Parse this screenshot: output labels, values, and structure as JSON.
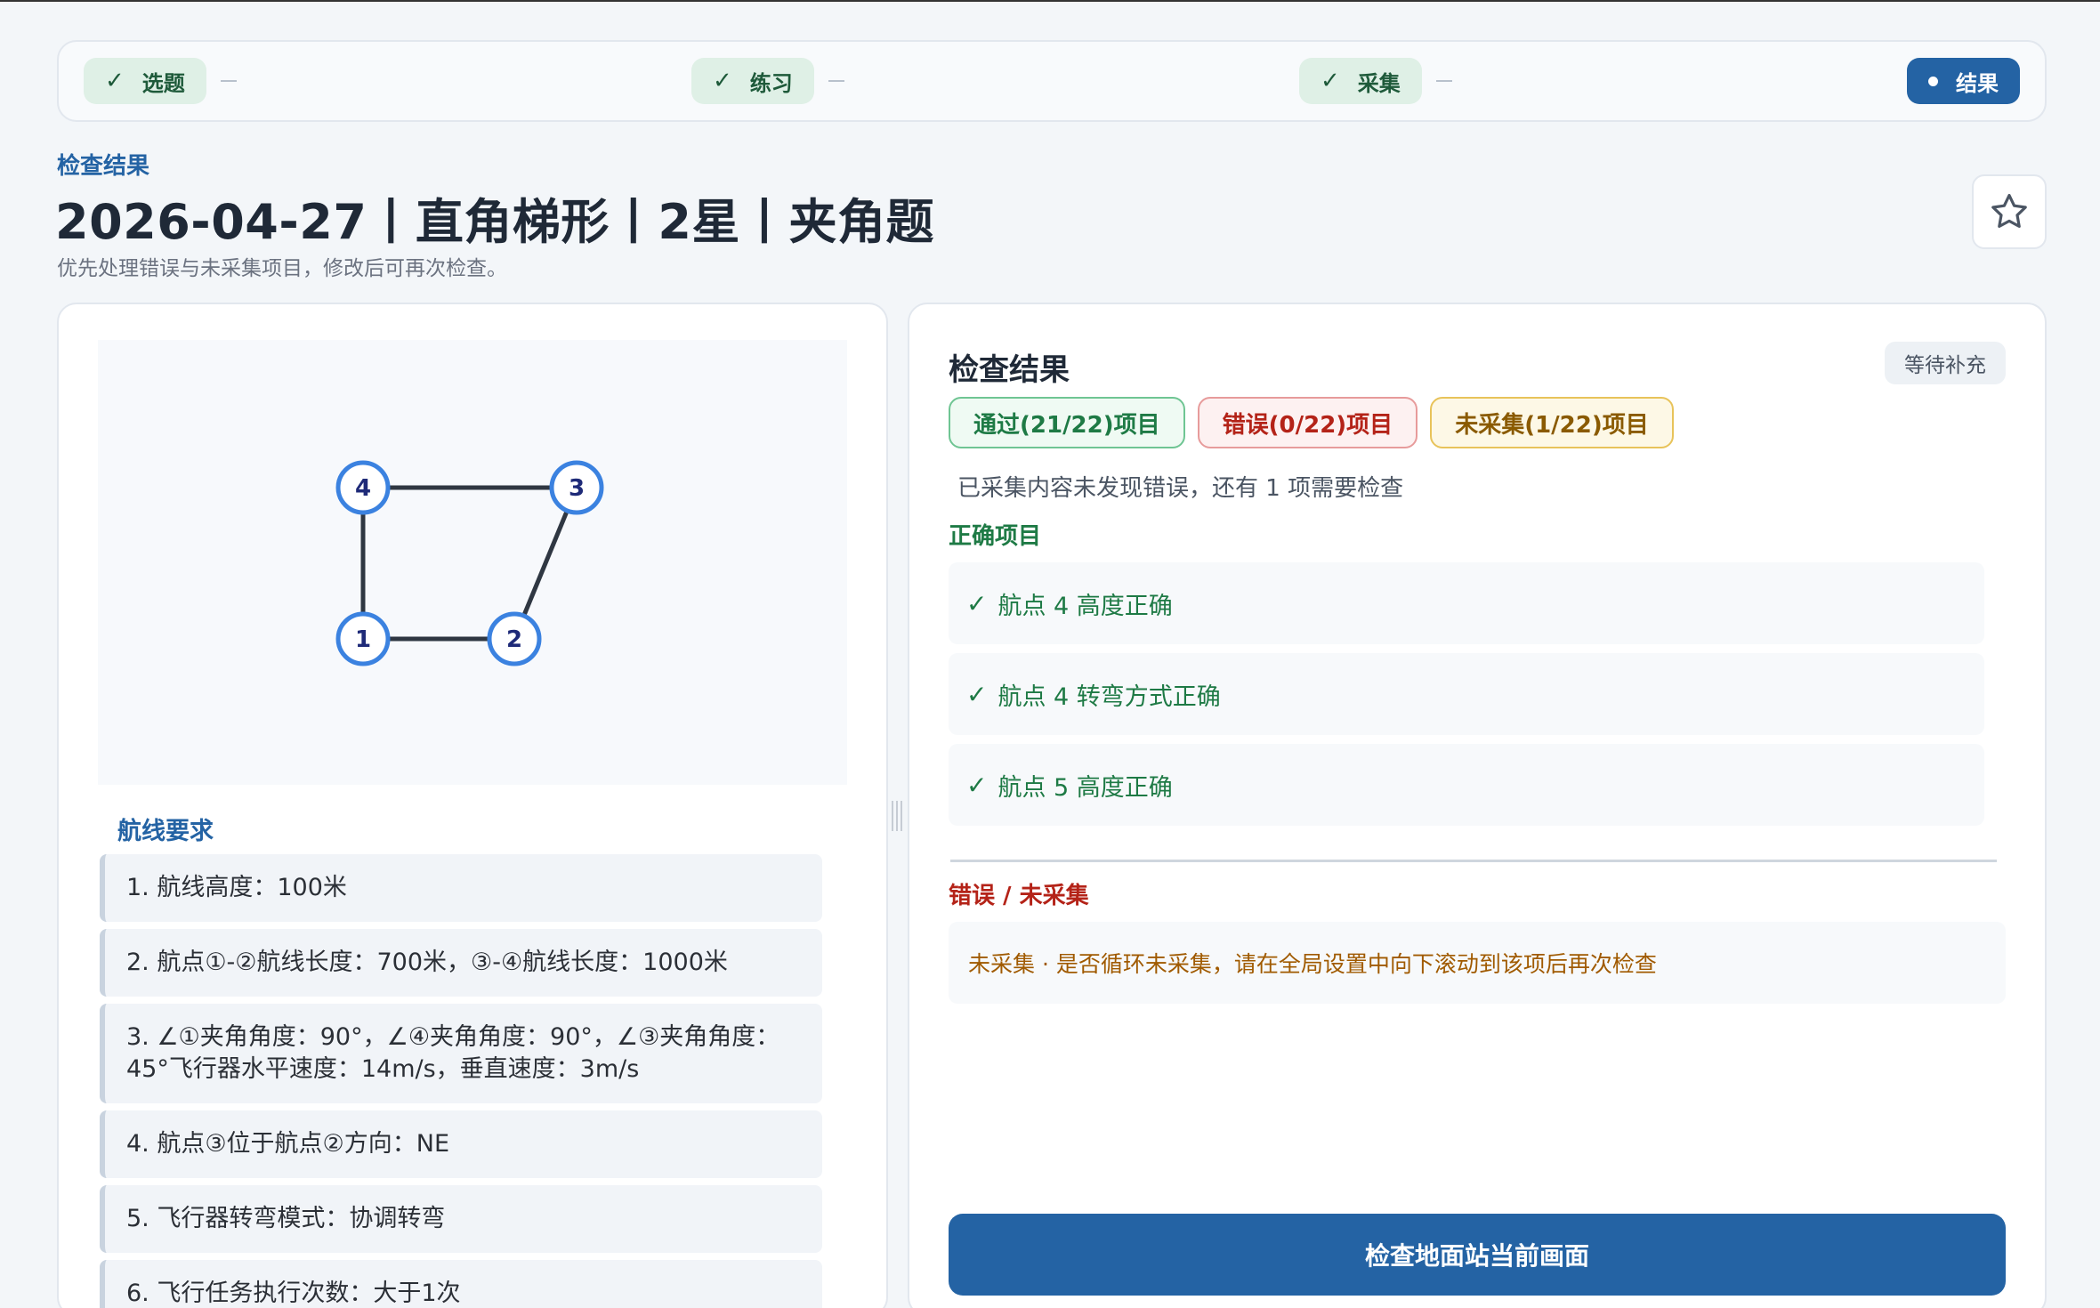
{
  "stepper": {
    "steps": [
      {
        "label": "选题",
        "state": "done"
      },
      {
        "label": "练习",
        "state": "done"
      },
      {
        "label": "采集",
        "state": "done"
      },
      {
        "label": "结果",
        "state": "active"
      }
    ],
    "done_icon": "check-icon",
    "active_icon": "dot-icon"
  },
  "header": {
    "eyebrow": "检查结果",
    "title": "2026-04-27丨直角梯形丨2星丨夹角题",
    "subtitle": "优先处理错误与未采集项目，修改后可再次检查。",
    "favorite_icon": "star-icon"
  },
  "diagram": {
    "waypoints": [
      {
        "label": "1"
      },
      {
        "label": "2"
      },
      {
        "label": "3"
      },
      {
        "label": "4"
      }
    ],
    "colors": {
      "node_stroke": "#3b82e0",
      "node_text": "#1e2a78",
      "edge": "#2f3742"
    }
  },
  "requirements": {
    "heading": "航线要求",
    "items": [
      "1. 航线高度：100米",
      "2. 航点①-②航线长度：700米，③-④航线长度：1000米",
      "3. ∠①夹角角度：90°，∠④夹角角度：90°，∠③夹角角度：45°飞行器水平速度：14m/s，垂直速度：3m/s",
      "4. 航点③位于航点②方向：NE",
      "5. 飞行器转弯模式：协调转弯",
      "6. 飞行任务执行次数：大于1次"
    ]
  },
  "results": {
    "title": "检查结果",
    "status": "等待补充",
    "badges": {
      "pass": "通过(21/22)项目",
      "error": "错误(0/22)项目",
      "pending": "未采集(1/22)项目"
    },
    "summary": "已采集内容未发现错误，还有 1 项需要检查",
    "correct_heading": "正确项目",
    "correct_items": [
      "航点 4 高度正确",
      "航点 4 转弯方式正确",
      "航点 5 高度正确"
    ],
    "correct_mark": "✓",
    "error_heading": "错误 / 未采集",
    "error_items": [
      "未采集 · 是否循环未采集，请在全局设置中向下滚动到该项后再次检查"
    ],
    "action_button": "检查地面站当前画面",
    "colors": {
      "pass": "#1e7a45",
      "error": "#b42318",
      "pending": "#8a5a00",
      "primary": "#2463a4"
    }
  }
}
